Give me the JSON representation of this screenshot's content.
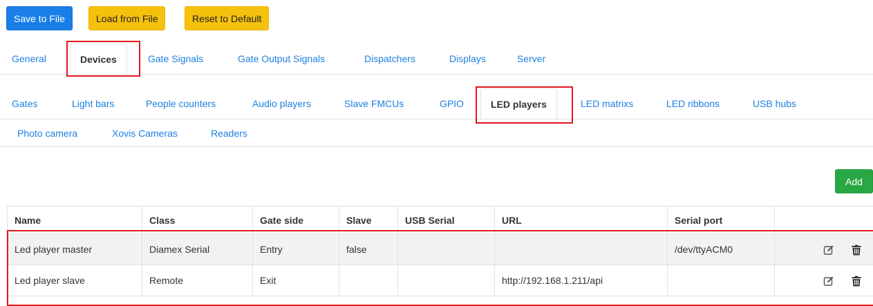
{
  "toolbar": {
    "save_label": "Save to File",
    "load_label": "Load from File",
    "reset_label": "Reset to Default",
    "add_label": "Add"
  },
  "main_tabs": [
    "General",
    "Devices",
    "Gate Signals",
    "Gate Output Signals",
    "Dispatchers",
    "Displays",
    "Server"
  ],
  "active_main_tab": "Devices",
  "sub_tabs": [
    "Gates",
    "Light bars",
    "People counters",
    "Audio players",
    "Slave FMCUs",
    "GPIO",
    "LED players",
    "LED matrixs",
    "LED ribbons",
    "USB hubs",
    "Photo camera",
    "Xovis Cameras",
    "Readers"
  ],
  "active_sub_tab": "LED players",
  "table": {
    "headers": [
      "Name",
      "Class",
      "Gate side",
      "Slave",
      "USB Serial",
      "URL",
      "Serial port",
      ""
    ],
    "rows": [
      [
        "Led player master",
        "Diamex Serial",
        "Entry",
        "false",
        "",
        "",
        "/dev/ttyACM0"
      ],
      [
        "Led player slave",
        "Remote",
        "Exit",
        "",
        "",
        "http://192.168.1.211/api",
        ""
      ]
    ],
    "row_actions": [
      "edit-icon",
      "trash-icon"
    ]
  },
  "colors": {
    "primary": "#1a7ee8",
    "warning": "#f5c10d",
    "success": "#2aa745",
    "link": "#1d7fe3",
    "highlight": "#e0151a"
  }
}
